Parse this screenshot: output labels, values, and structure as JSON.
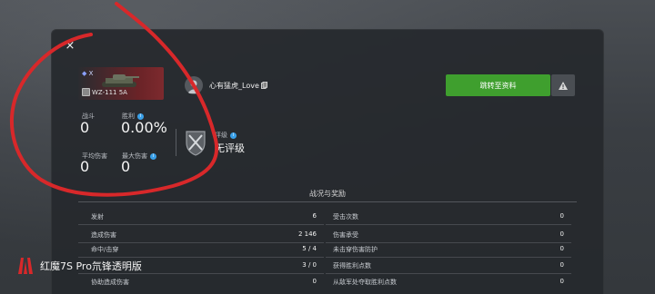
{
  "window": {
    "close_label": "×"
  },
  "tank": {
    "tier": "Ⅹ",
    "name": "WZ-111 5A"
  },
  "player": {
    "name": "心有猛虎_Love"
  },
  "stats": {
    "battles_label": "战斗",
    "battles_value": "0",
    "winrate_label": "胜利",
    "winrate_value": "0.00%",
    "avg_damage_label": "平均伤害",
    "avg_damage_value": "0",
    "max_damage_label": "最大伤害",
    "max_damage_value": "0",
    "rating_label": "评级",
    "rating_value": "无评级"
  },
  "actions": {
    "profile_button": "跳转至资料"
  },
  "battle_stats": {
    "title": "战况与奖励",
    "left": [
      {
        "label": "发射",
        "value": "6"
      },
      {
        "label": "造成伤害",
        "value": "2 146"
      },
      {
        "label": "命中/击穿",
        "value": "5 / 4"
      },
      {
        "label": "",
        "value": "3 / 0"
      },
      {
        "label": "协助造成伤害",
        "value": "0"
      }
    ],
    "right": [
      {
        "label": "受击次数",
        "value": "0"
      },
      {
        "label": "伤害承受",
        "value": "0"
      },
      {
        "label": "未击穿伤害防护",
        "value": "0"
      },
      {
        "label": "获得胜利点数",
        "value": "0"
      },
      {
        "label": "从敌军处夺取胜利点数",
        "value": "0"
      }
    ]
  },
  "watermark": {
    "text": "红魔7S Pro氘锋透明版"
  },
  "colors": {
    "accent_green": "#3f9f2e",
    "info_blue": "#3aa0e8",
    "annotation_red": "#d8282a"
  }
}
